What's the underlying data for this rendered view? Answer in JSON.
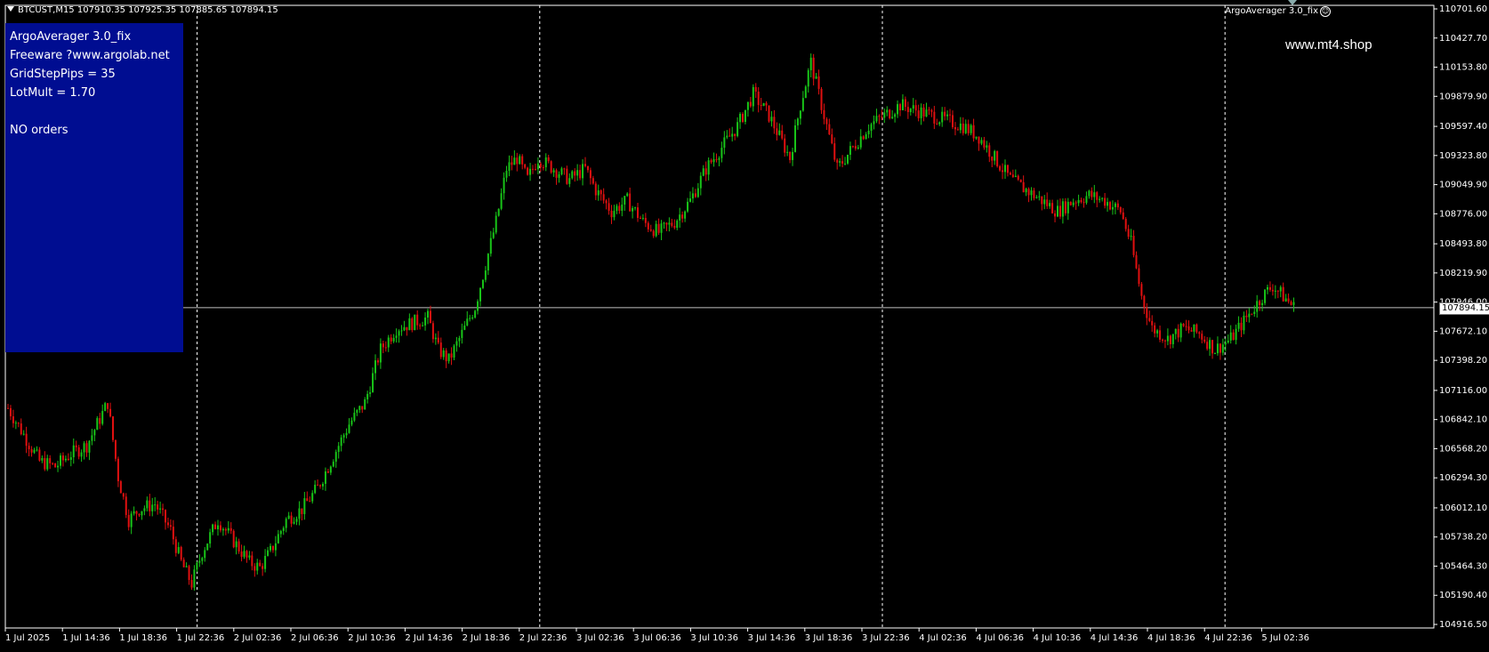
{
  "header": {
    "symbol_timeframe": "BTCUST,M15",
    "ohlc": "107910.35 107925.35 107885.65 107894.15"
  },
  "expert": {
    "label": "ArgoAverager 3.0_fix",
    "smiley_icon": "smiley-icon"
  },
  "info_panel": {
    "title": "ArgoAverager 3.0_fix",
    "line2": "Freeware ?www.argolab.net",
    "line3": "GridStepPips = 35",
    "line4": "LotMult = 1.70",
    "status": "NO orders",
    "bg_color": "#000d91"
  },
  "watermark": "www.mt4.shop",
  "current_price_label": "107894.15",
  "colors": {
    "bull": "#18c418",
    "bear": "#e01010",
    "background": "#000000",
    "grid": "#ffffff"
  },
  "chart_data": {
    "type": "candlestick",
    "current_price": 107894.15,
    "ylim": [
      104916.5,
      110701.6
    ],
    "y_ticks": [
      "110701.60",
      "110427.70",
      "110153.80",
      "109879.90",
      "109597.40",
      "109323.80",
      "109049.90",
      "108776.00",
      "108493.80",
      "108219.90",
      "107946.00",
      "107672.10",
      "107398.20",
      "107116.00",
      "106842.10",
      "106568.20",
      "106294.30",
      "106012.10",
      "105738.20",
      "105464.30",
      "105190.40",
      "104916.50"
    ],
    "x_ticks": [
      "1 Jul 2025",
      "1 Jul 14:36",
      "1 Jul 18:36",
      "1 Jul 22:36",
      "2 Jul 02:36",
      "2 Jul 06:36",
      "2 Jul 10:36",
      "2 Jul 14:36",
      "2 Jul 18:36",
      "2 Jul 22:36",
      "3 Jul 02:36",
      "3 Jul 06:36",
      "3 Jul 10:36",
      "3 Jul 14:36",
      "3 Jul 18:36",
      "3 Jul 22:36",
      "4 Jul 02:36",
      "4 Jul 06:36",
      "4 Jul 10:36",
      "4 Jul 14:36",
      "4 Jul 18:36",
      "4 Jul 22:36",
      "5 Jul 02:36"
    ],
    "day_separators_after": [
      "1 Jul 22:36",
      "2 Jul 22:36",
      "3 Jul 22:36",
      "4 Jul 22:36"
    ],
    "close_path": [
      [
        0,
        106950
      ],
      [
        6,
        106700
      ],
      [
        12,
        106450
      ],
      [
        18,
        106400
      ],
      [
        24,
        106520
      ],
      [
        30,
        106600
      ],
      [
        34,
        106800
      ],
      [
        38,
        107000
      ],
      [
        42,
        106300
      ],
      [
        46,
        105900
      ],
      [
        50,
        106000
      ],
      [
        56,
        106050
      ],
      [
        62,
        105800
      ],
      [
        66,
        105500
      ],
      [
        70,
        105300
      ],
      [
        74,
        105600
      ],
      [
        80,
        105900
      ],
      [
        86,
        105700
      ],
      [
        92,
        105500
      ],
      [
        96,
        105450
      ],
      [
        100,
        105600
      ],
      [
        106,
        105900
      ],
      [
        112,
        106000
      ],
      [
        118,
        106200
      ],
      [
        124,
        106500
      ],
      [
        130,
        106800
      ],
      [
        136,
        107000
      ],
      [
        142,
        107500
      ],
      [
        148,
        107700
      ],
      [
        154,
        107750
      ],
      [
        160,
        107800
      ],
      [
        164,
        107500
      ],
      [
        168,
        107400
      ],
      [
        172,
        107600
      ],
      [
        178,
        107900
      ],
      [
        182,
        108300
      ],
      [
        186,
        108700
      ],
      [
        190,
        109200
      ],
      [
        194,
        109300
      ],
      [
        198,
        109100
      ],
      [
        202,
        109300
      ],
      [
        208,
        109200
      ],
      [
        214,
        109100
      ],
      [
        220,
        109200
      ],
      [
        224,
        109000
      ],
      [
        230,
        108800
      ],
      [
        236,
        108900
      ],
      [
        242,
        108700
      ],
      [
        248,
        108600
      ],
      [
        254,
        108700
      ],
      [
        260,
        108900
      ],
      [
        266,
        109200
      ],
      [
        272,
        109400
      ],
      [
        278,
        109600
      ],
      [
        284,
        109900
      ],
      [
        290,
        109700
      ],
      [
        294,
        109500
      ],
      [
        298,
        109300
      ],
      [
        302,
        109800
      ],
      [
        306,
        110200
      ],
      [
        310,
        109800
      ],
      [
        316,
        109200
      ],
      [
        322,
        109400
      ],
      [
        328,
        109600
      ],
      [
        334,
        109700
      ],
      [
        340,
        109800
      ],
      [
        346,
        109750
      ],
      [
        352,
        109700
      ],
      [
        358,
        109650
      ],
      [
        364,
        109600
      ],
      [
        370,
        109500
      ],
      [
        376,
        109300
      ],
      [
        382,
        109100
      ],
      [
        388,
        109000
      ],
      [
        394,
        108900
      ],
      [
        400,
        108800
      ],
      [
        406,
        108900
      ],
      [
        412,
        108950
      ],
      [
        418,
        108900
      ],
      [
        424,
        108800
      ],
      [
        428,
        108500
      ],
      [
        432,
        108000
      ],
      [
        436,
        107700
      ],
      [
        442,
        107600
      ],
      [
        448,
        107700
      ],
      [
        454,
        107650
      ],
      [
        460,
        107500
      ],
      [
        466,
        107600
      ],
      [
        472,
        107800
      ],
      [
        478,
        108000
      ],
      [
        482,
        108100
      ],
      [
        486,
        108000
      ],
      [
        490,
        107900
      ]
    ]
  }
}
